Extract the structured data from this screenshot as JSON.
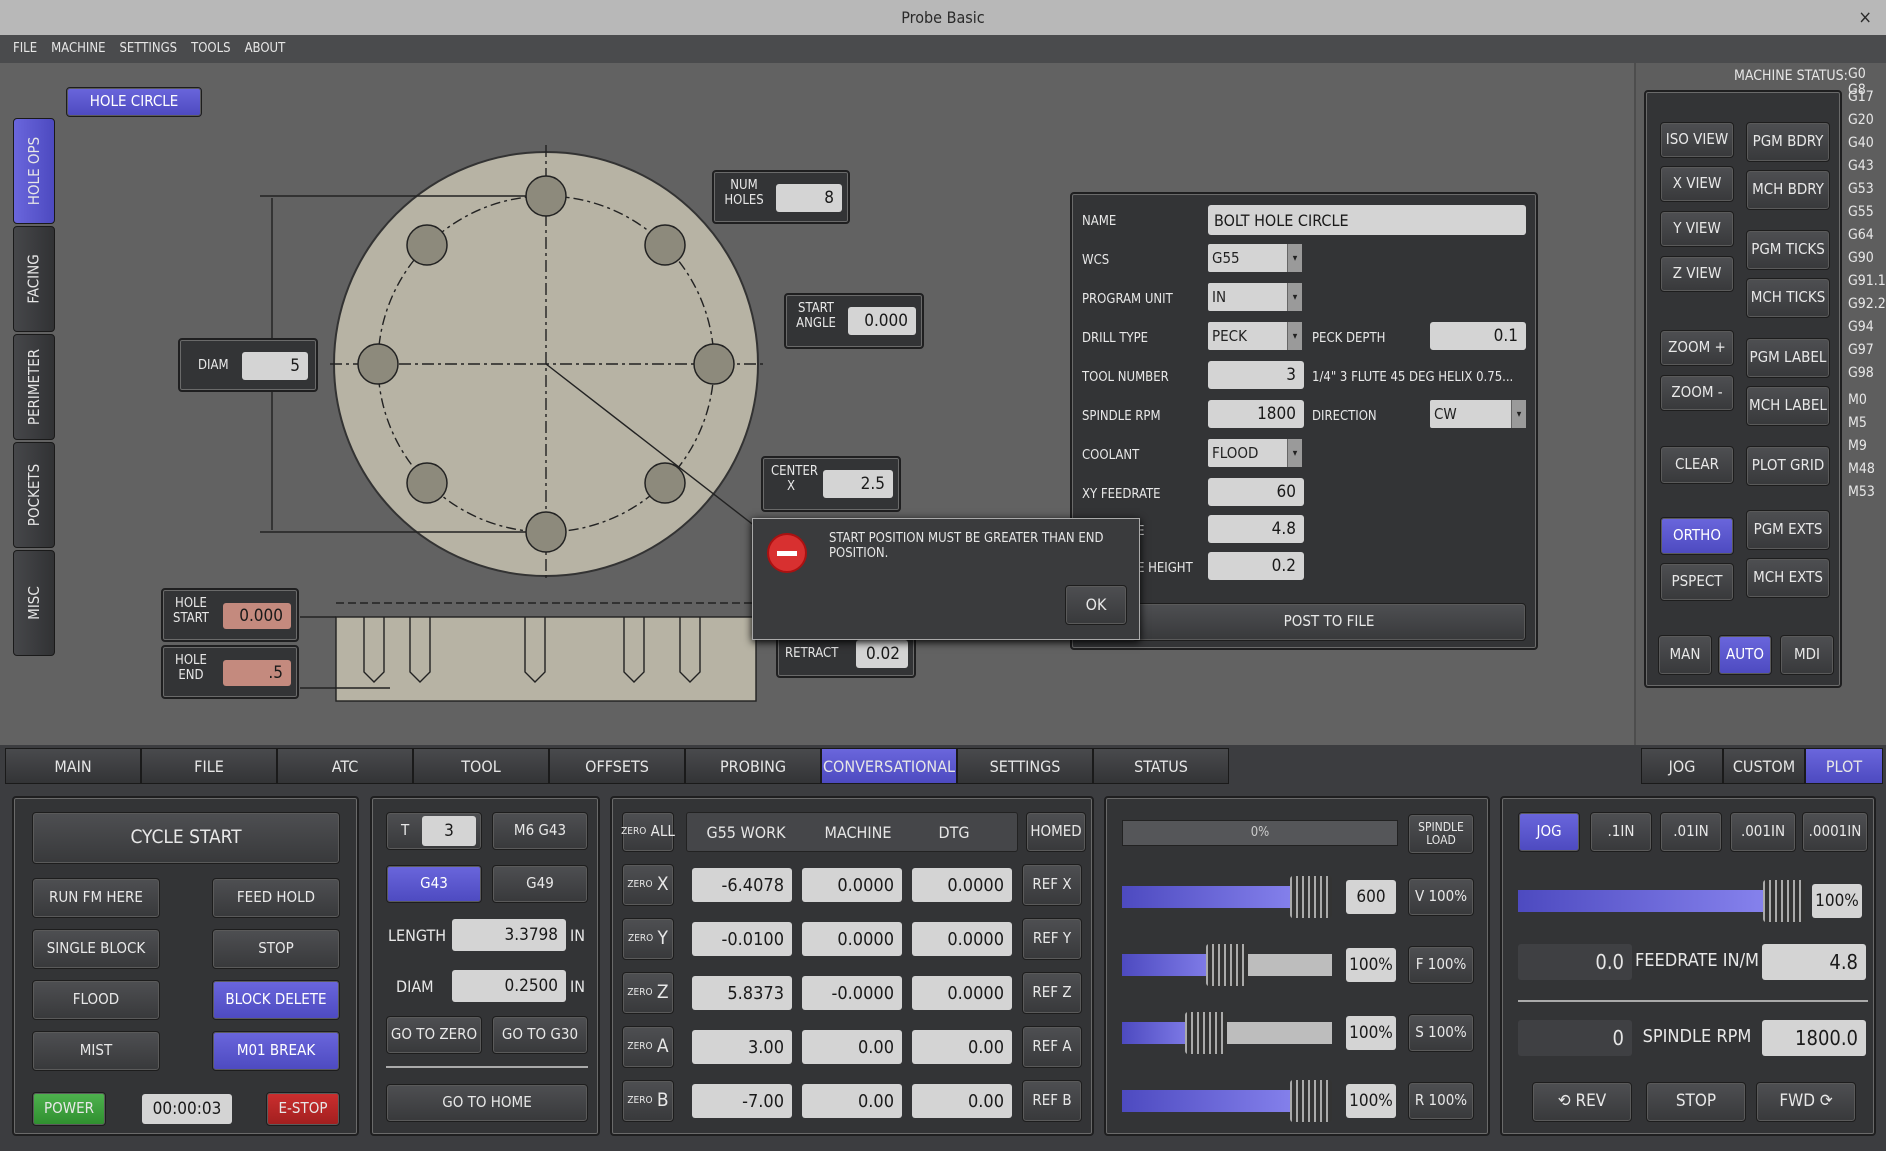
{
  "window": {
    "title": "Probe Basic",
    "close": "×"
  },
  "menu": [
    "FILE",
    "MACHINE",
    "SETTINGS",
    "TOOLS",
    "ABOUT"
  ],
  "side_tabs": [
    "HOLE OPS",
    "FACING",
    "PERIMETER",
    "POCKETS",
    "MISC"
  ],
  "hole_circle": {
    "title": "HOLE CIRCLE",
    "num_holes_label": "NUM\nHOLES",
    "num_holes": "8",
    "start_angle_label": "START\nANGLE",
    "start_angle": "0.000",
    "diam_label": "DIAM",
    "diam": "5",
    "center_x_label": "CENTER\nX",
    "center_x": "2.5",
    "hole_start_label": "HOLE\nSTART",
    "hole_start": "0.000",
    "hole_end_label": "HOLE\nEND",
    "hole_end": ".5",
    "retract_label": "RETRACT",
    "retract": "0.02"
  },
  "form": {
    "name_label": "NAME",
    "name": "BOLT HOLE CIRCLE",
    "wcs_label": "WCS",
    "wcs": "G55",
    "unit_label": "PROGRAM UNIT",
    "unit": "IN",
    "drill_label": "DRILL TYPE",
    "drill": "PECK",
    "peck_label": "PECK DEPTH",
    "peck": "0.1",
    "tool_label": "TOOL NUMBER",
    "tool": "3",
    "tool_desc": "1/4\" 3 FLUTE 45 DEG HELIX 0.75...",
    "rpm_label": "SPINDLE RPM",
    "rpm": "1800",
    "dir_label": "DIRECTION",
    "dir": "CW",
    "coolant_label": "COOLANT",
    "coolant": "FLOOD",
    "xyfeed_label": "XY FEEDRATE",
    "xyfeed": "60",
    "zfeed_label_tail": "E",
    "zfeed": "4.8",
    "clear_label_tail": "E HEIGHT",
    "clear": "0.2",
    "post": "POST TO FILE"
  },
  "dialog": {
    "message": "START POSITION MUST BE GREATER THAN END POSITION.",
    "ok": "OK"
  },
  "status": {
    "title": "MACHINE STATUS:",
    "codes": [
      "G0 G8",
      "G17",
      "G20",
      "G40",
      "G43",
      "G53",
      "G55",
      "G64",
      "G90",
      "G91.1",
      "G92.2",
      "G94",
      "G97",
      "G98",
      "M0",
      "M5",
      "M9",
      "M48",
      "M53"
    ],
    "buttons": [
      "ISO VIEW",
      "PGM BDRY",
      "X VIEW",
      "MCH BDRY",
      "Y VIEW",
      "PGM TICKS",
      "Z VIEW",
      "MCH TICKS",
      "ZOOM +",
      "PGM LABEL",
      "ZOOM -",
      "MCH LABEL",
      "CLEAR",
      "PLOT GRID",
      "ORTHO",
      "PGM EXTS",
      "PSPECT",
      "MCH EXTS",
      "MAN",
      "AUTO",
      "MDI"
    ]
  },
  "tabs": [
    "MAIN",
    "FILE",
    "ATC",
    "TOOL",
    "OFFSETS",
    "PROBING",
    "CONVERSATIONAL",
    "SETTINGS",
    "STATUS"
  ],
  "right_tabs": [
    "JOG",
    "CUSTOM",
    "PLOT"
  ],
  "control": {
    "cycle_start": "CYCLE START",
    "run_fm_here": "RUN FM HERE",
    "feed_hold": "FEED HOLD",
    "single_block": "SINGLE BLOCK",
    "stop": "STOP",
    "flood": "FLOOD",
    "block_delete": "BLOCK DELETE",
    "mist": "MIST",
    "m01_break": "M01 BREAK",
    "power": "POWER",
    "timer": "00:00:03",
    "estop": "E-STOP"
  },
  "tool": {
    "t_label": "T",
    "t": "3",
    "m6": "M6 G43",
    "g43": "G43",
    "g49": "G49",
    "length_label": "LENGTH",
    "length": "3.3798",
    "diam_label": "DIAM",
    "diam": "0.2500",
    "unit": "IN",
    "go_zero": "GO TO ZERO",
    "go_g30": "GO TO G30",
    "go_home": "GO TO HOME"
  },
  "dro": {
    "zero_all": "ALL",
    "zero_small": "ZERO",
    "headers": [
      "G55 WORK",
      "MACHINE",
      "DTG"
    ],
    "homed": "HOMED",
    "rows": [
      {
        "axis": "X",
        "work": "-6.4078",
        "mach": "0.0000",
        "dtg": "0.0000",
        "ref": "REF X"
      },
      {
        "axis": "Y",
        "work": "-0.0100",
        "mach": "0.0000",
        "dtg": "0.0000",
        "ref": "REF Y"
      },
      {
        "axis": "Z",
        "work": "5.8373",
        "mach": "-0.0000",
        "dtg": "0.0000",
        "ref": "REF Z"
      },
      {
        "axis": "A",
        "work": "3.00",
        "mach": "0.00",
        "dtg": "0.00",
        "ref": "REF A"
      },
      {
        "axis": "B",
        "work": "-7.00",
        "mach": "0.00",
        "dtg": "0.00",
        "ref": "REF B"
      }
    ]
  },
  "overrides": {
    "load": "0%",
    "load_value": 0,
    "spindle_load": "SPINDLE\nLOAD",
    "rows": [
      {
        "value": "600",
        "btn": "V 100%",
        "level": 0.9
      },
      {
        "value": "100%",
        "btn": "F 100%",
        "level": 0.5
      },
      {
        "value": "100%",
        "btn": "S 100%",
        "level": 0.4
      },
      {
        "value": "100%",
        "btn": "R 100%",
        "level": 0.9
      }
    ]
  },
  "jog": {
    "jog": "JOG",
    "steps": [
      ".1IN",
      ".01IN",
      ".001IN",
      ".0001IN"
    ],
    "pct": "100%",
    "level": 0.95,
    "feed_cur": "0.0",
    "feed_label": "FEEDRATE IN/M",
    "feed_set": "4.8",
    "rpm_cur": "0",
    "rpm_label": "SPINDLE RPM",
    "rpm_set": "1800.0",
    "rev": "⟲ REV",
    "stop": "STOP",
    "fwd": "FWD ⟳"
  }
}
